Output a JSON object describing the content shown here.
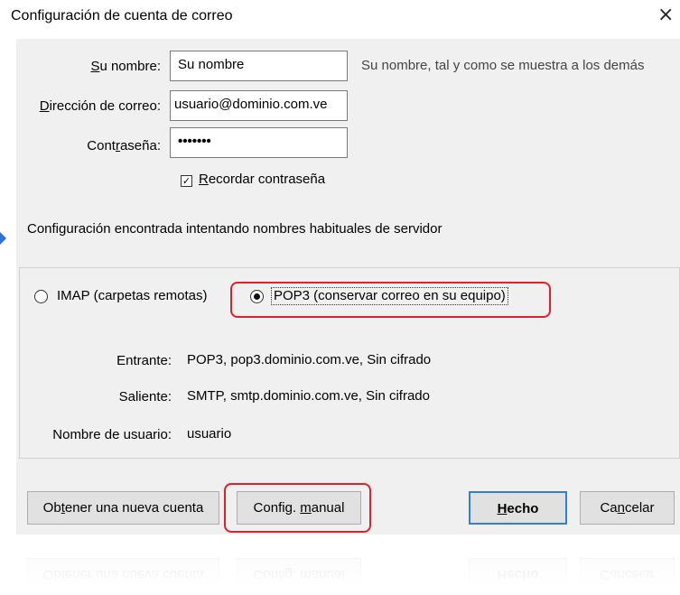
{
  "window": {
    "title": "Configuración de cuenta de correo",
    "close_glyph": "×"
  },
  "form": {
    "name_label_u": "S",
    "name_label_rest": "u nombre:",
    "name_value": "Su nombre",
    "name_hint": "Su nombre, tal y como se muestra a los demás",
    "email_label_u": "D",
    "email_label_rest": "irección de correo:",
    "email_value": "usuario@dominio.com.ve",
    "password_label_pre": "Cont",
    "password_label_u": "r",
    "password_label_rest": "aseña:",
    "password_value": "•••••••",
    "remember_checked": true,
    "remember_u": "R",
    "remember_rest": "ecordar contraseña"
  },
  "status_text": "Configuración encontrada intentando nombres habituales de servidor",
  "protocol": {
    "imap_label": "IMAP (carpetas remotas)",
    "pop3_label": "POP3 (conservar correo en su equipo)",
    "selected": "POP3"
  },
  "servers": {
    "incoming_label": "Entrante:",
    "incoming_value": "POP3, pop3.dominio.com.ve, Sin cifrado",
    "outgoing_label": "Saliente:",
    "outgoing_value": "SMTP, smtp.dominio.com.ve, Sin cifrado",
    "username_label": "Nombre de usuario:",
    "username_value": "usuario"
  },
  "buttons": {
    "new_account_pre": "Ob",
    "new_account_u": "t",
    "new_account_rest": "ener una nueva cuenta",
    "manual_pre": "Config. ",
    "manual_u": "m",
    "manual_rest": "anual",
    "done_u": "H",
    "done_rest": "echo",
    "cancel_pre": "Ca",
    "cancel_u": "n",
    "cancel_rest": "celar"
  },
  "colors": {
    "highlight": "#e0202a",
    "default_button_border": "#2f7fd6",
    "dialog_bg": "#f0f0f0"
  }
}
